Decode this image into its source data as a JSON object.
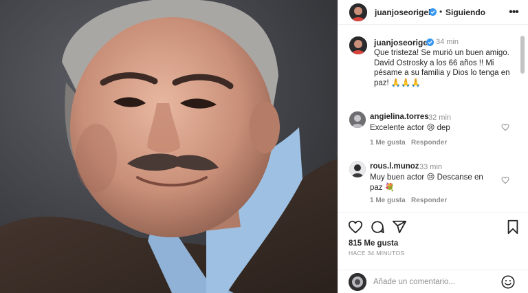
{
  "post": {
    "username": "juanjoseorigel",
    "follow_status": "Siguiendo",
    "separator": "•",
    "more_label": "•••",
    "caption_username": "juanjoseorigel",
    "caption_time": "34 min",
    "caption_text": "Que tristeza! Se murió un buen amigo. David Ostrosky a los 66 años !! Mi pésame a su familia y Dios lo tenga en paz! 🙏🙏🙏"
  },
  "comments": [
    {
      "username": "angielina.torres",
      "time": "32 min",
      "text": "Excelente actor 😢 dep",
      "like_label": "1 Me gusta",
      "reply_label": "Responder"
    },
    {
      "username": "rous.l.munoz",
      "time": "33 min",
      "text": "Muy buen actor 😢 Descanse en paz 💐",
      "like_label": "1 Me gusta",
      "reply_label": "Responder"
    }
  ],
  "engagement": {
    "likes": "815 Me gusta",
    "posted_ago": "HACE 34 MINUTOS"
  },
  "composer": {
    "placeholder": "Añade un comentario..."
  },
  "colors": {
    "verified": "#3897f0",
    "text": "#262626",
    "muted": "#8e8e8e",
    "border": "#efefef"
  },
  "icons": [
    "verified-badge-icon",
    "more-options-icon",
    "heart-icon",
    "comment-icon",
    "share-icon",
    "save-icon",
    "emoji-icon"
  ]
}
